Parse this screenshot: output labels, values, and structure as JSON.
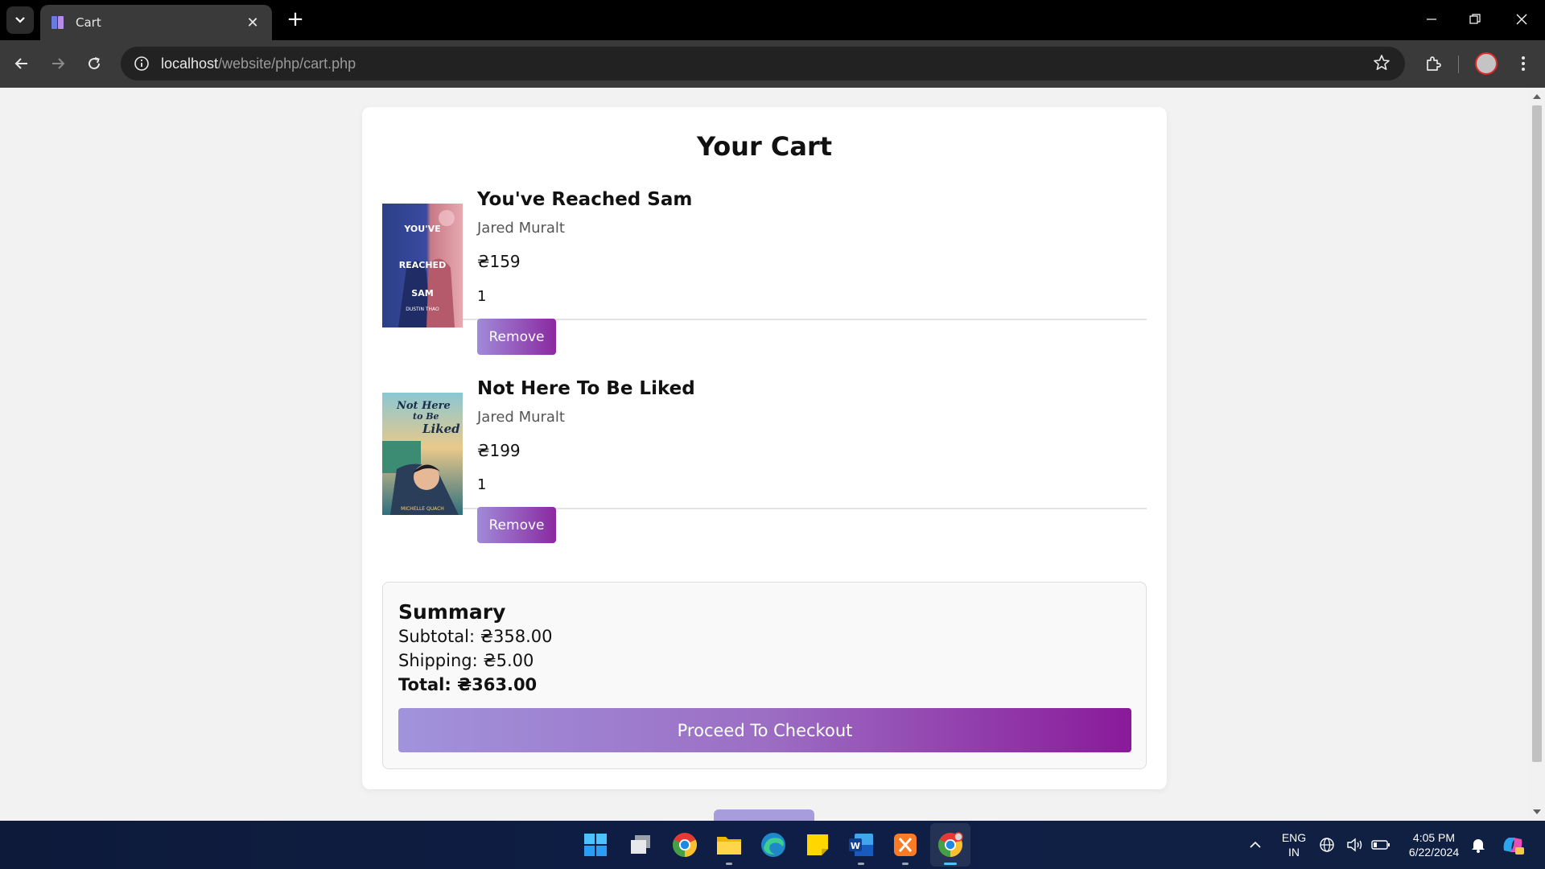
{
  "browser": {
    "tab_title": "Cart",
    "url_host": "localhost",
    "url_path": "/website/php/cart.php"
  },
  "page": {
    "title": "Your Cart",
    "items": [
      {
        "title": "You've Reached Sam",
        "author": "Jared Muralt",
        "price": "₴159",
        "quantity": "1",
        "remove_label": "Remove",
        "cover_text": [
          "YOU'VE",
          "REACHED",
          "SAM",
          "DUSTIN THAO"
        ]
      },
      {
        "title": "Not Here To Be Liked",
        "author": "Jared Muralt",
        "price": "₴199",
        "quantity": "1",
        "remove_label": "Remove",
        "cover_text": [
          "Not Here",
          "to Be",
          "Liked",
          "MICHELLE QUACH"
        ]
      }
    ],
    "summary": {
      "title": "Summary",
      "subtitle_label": "Subtotal: ₴358.00",
      "shipping_label": "Shipping: ₴5.00",
      "total_label": "Total: ₴363.00",
      "checkout_label": "Proceed To Checkout"
    }
  },
  "taskbar": {
    "lang_top": "ENG",
    "lang_bottom": "IN",
    "time": "4:05 PM",
    "date": "6/22/2024"
  },
  "colors": {
    "button_gradient_start": "#a08ad8",
    "button_gradient_end": "#8a2aa0"
  }
}
